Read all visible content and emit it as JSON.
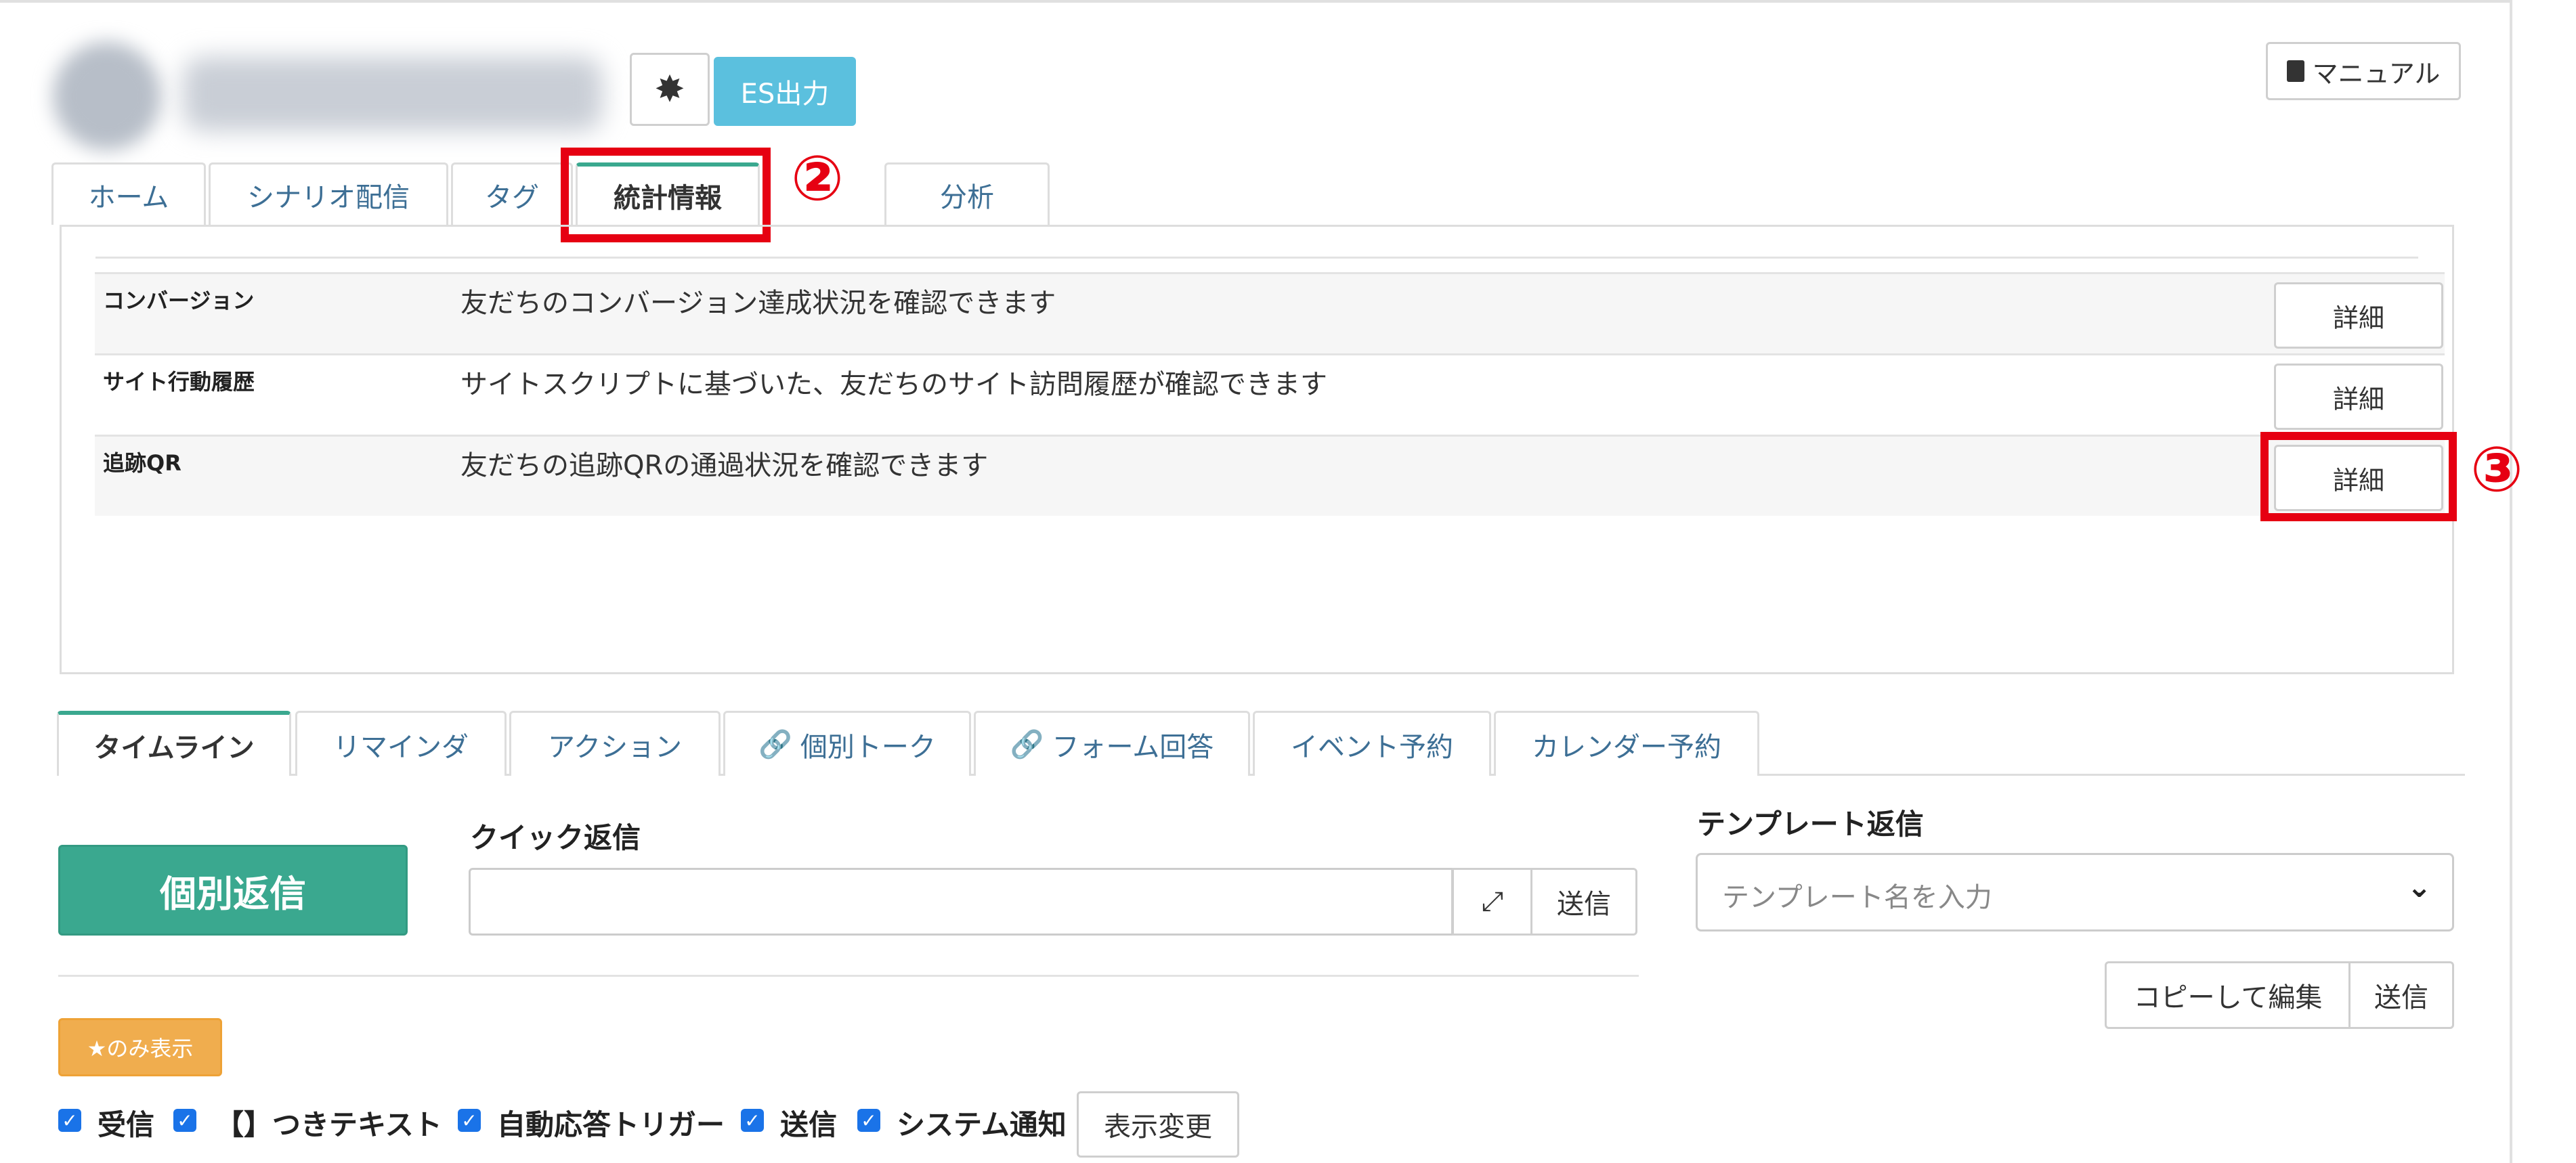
{
  "header": {
    "settings_icon": "gear-icon",
    "es_export_label": "ES出力",
    "manual_label": "マニュアル",
    "manual_icon": "book-icon"
  },
  "top_tabs": [
    {
      "label": "ホーム",
      "active": false
    },
    {
      "label": "シナリオ配信",
      "active": false
    },
    {
      "label": "タグ",
      "active": false
    },
    {
      "label": "統計情報",
      "active": true
    },
    {
      "label": "分析",
      "active": false
    }
  ],
  "annotations": {
    "step2": "②",
    "step3": "③"
  },
  "stats": {
    "rows": [
      {
        "name": "コンバージョン",
        "description": "友だちのコンバージョン達成状況を確認できます",
        "button": "詳細"
      },
      {
        "name": "サイト行動履歴",
        "description": "サイトスクリプトに基づいた、友だちのサイト訪問履歴が確認できます",
        "button": "詳細"
      },
      {
        "name": "追跡QR",
        "description": "友だちの追跡QRの通過状況を確認できます",
        "button": "詳細"
      }
    ]
  },
  "bottom_tabs": [
    {
      "label": "タイムライン",
      "active": true
    },
    {
      "label": "リマインダ",
      "active": false
    },
    {
      "label": "アクション",
      "active": false
    },
    {
      "label": "個別トーク",
      "active": false,
      "icon": "link-icon"
    },
    {
      "label": "フォーム回答",
      "active": false,
      "icon": "link-icon"
    },
    {
      "label": "イベント予約",
      "active": false
    },
    {
      "label": "カレンダー予約",
      "active": false
    }
  ],
  "reply": {
    "individual_reply_label": "個別返信",
    "quick_reply_title": "クイック返信",
    "quick_reply_value": "",
    "quick_send_label": "送信",
    "expand_icon": "expand-icon",
    "template_title": "テンプレート返信",
    "template_placeholder": "テンプレート名を入力",
    "copy_edit_label": "コピーして編集",
    "template_send_label": "送信"
  },
  "filters": {
    "star_only_label": "★のみ表示",
    "items": [
      {
        "label": "受信",
        "checked": true
      },
      {
        "label": "【】つきテキスト",
        "checked": true
      },
      {
        "label": "自動応答トリガー",
        "checked": true
      },
      {
        "label": "送信",
        "checked": true
      },
      {
        "label": "システム通知",
        "checked": true
      }
    ],
    "apply_label": "表示変更"
  },
  "colors": {
    "accent_teal": "#3aa88f",
    "es_button": "#5bc0de",
    "star_button": "#f0ad4e",
    "annotation_red": "#e60012",
    "checkbox_blue": "#1a73e8"
  }
}
